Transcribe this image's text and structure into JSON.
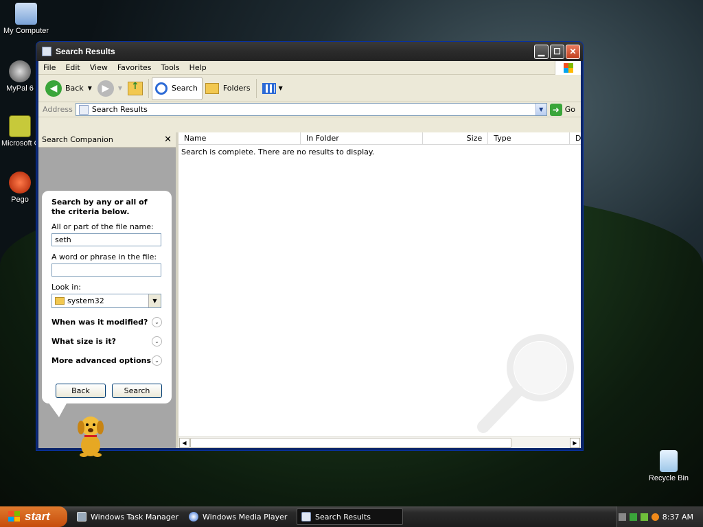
{
  "desktop": {
    "icons": [
      {
        "label": "My Computer"
      },
      {
        "label": "MyPal 6"
      },
      {
        "label": "Microsoft Outlook"
      },
      {
        "label": "Pego"
      },
      {
        "label": "Recycle Bin"
      }
    ]
  },
  "window": {
    "title": "Search Results",
    "menu": [
      "File",
      "Edit",
      "View",
      "Favorites",
      "Tools",
      "Help"
    ],
    "toolbar": {
      "back": "Back",
      "search": "Search",
      "folders": "Folders"
    },
    "address": {
      "label": "Address",
      "value": "Search Results",
      "go": "Go"
    },
    "companion": {
      "title": "Search Companion",
      "heading": "Search by any or all of the criteria below.",
      "filename_label": "All or part of the file name:",
      "filename_value": "seth",
      "phrase_label": "A word or phrase in the file:",
      "phrase_value": "",
      "lookin_label": "Look in:",
      "lookin_value": "system32",
      "expanders": [
        "When was it modified?",
        "What size is it?",
        "More advanced options"
      ],
      "back_button": "Back",
      "search_button": "Search"
    },
    "results": {
      "columns": [
        "Name",
        "In Folder",
        "Size",
        "Type",
        "D"
      ],
      "message": "Search is complete. There are no results to display."
    }
  },
  "taskbar": {
    "start": "start",
    "tasks": [
      "Windows Task Manager",
      "Windows Media Player",
      "Search Results"
    ],
    "clock": "8:37 AM"
  },
  "colors": {
    "titlebar": "#2b2b2b",
    "close": "#c2401f",
    "start": "#d0621c"
  }
}
